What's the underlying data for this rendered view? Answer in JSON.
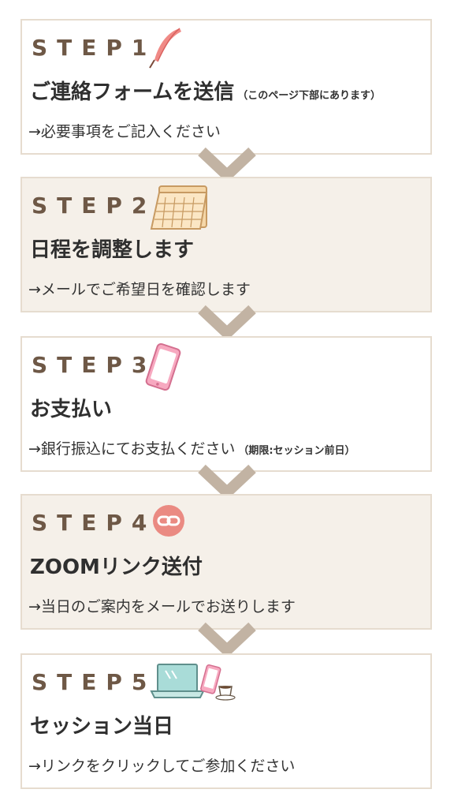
{
  "steps": [
    {
      "label": "STEP1",
      "heading": "ご連絡フォームを送信",
      "heading_note": "（このページ下部にあります）",
      "desc": "→必要事項をご記入ください",
      "desc_note": "",
      "icon": "quill-pen-icon"
    },
    {
      "label": "STEP2",
      "heading": "日程を調整します",
      "heading_note": "",
      "desc": "→メールでご希望日を確認します",
      "desc_note": "",
      "icon": "calendar-icon"
    },
    {
      "label": "STEP3",
      "heading": "お支払い",
      "heading_note": "",
      "desc": "→銀行振込にてお支払ください",
      "desc_note": "（期限:セッション前日）",
      "icon": "smartphone-icon"
    },
    {
      "label": "STEP4",
      "heading": "ZOOMリンク送付",
      "heading_note": "",
      "desc": "→当日のご案内をメールでお送りします",
      "desc_note": "",
      "icon": "link-icon"
    },
    {
      "label": "STEP5",
      "heading": "セッション当日",
      "heading_note": "",
      "desc": "→リンクをクリックしてご参加ください",
      "desc_note": "",
      "icon": "laptop-coffee-icon"
    }
  ],
  "colors": {
    "label": "#6e5846",
    "beige": "#f5f0e9",
    "border": "#e6dccf",
    "chevron": "#c2b3a3"
  }
}
